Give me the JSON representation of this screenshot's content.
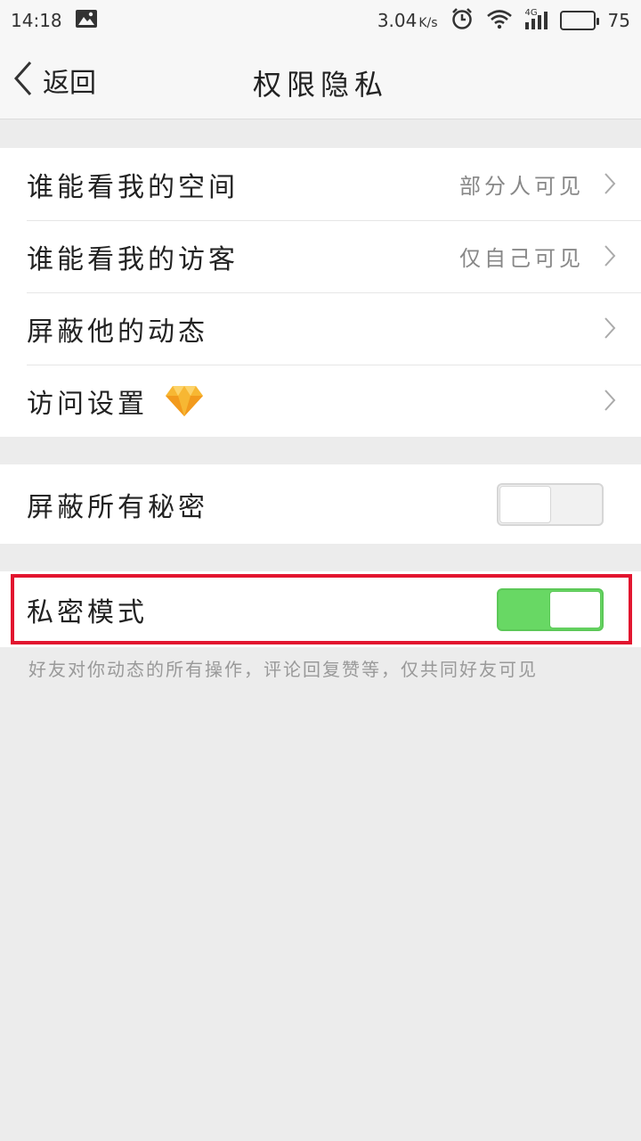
{
  "status_bar": {
    "time": "14:18",
    "speed": "3.04",
    "speed_unit": "K/s",
    "network": "4G",
    "battery": "75"
  },
  "header": {
    "back_label": "返回",
    "title": "权限隐私"
  },
  "privacy_settings": [
    {
      "label": "谁能看我的空间",
      "value": "部分人可见"
    },
    {
      "label": "谁能看我的访客",
      "value": "仅自己可见"
    },
    {
      "label": "屏蔽他的动态",
      "value": ""
    },
    {
      "label": "访问设置",
      "value": "",
      "badge_icon": "diamond-icon"
    }
  ],
  "block_secrets": {
    "label": "屏蔽所有秘密",
    "enabled": false
  },
  "private_mode": {
    "label": "私密模式",
    "enabled": true
  },
  "private_mode_note": "好友对你动态的所有操作，评论回复赞等，仅共同好友可见",
  "colors": {
    "toggle_on": "#68d864",
    "highlight": "#e2152f",
    "background": "#ececec"
  },
  "icons": {
    "back": "chevron-left-icon",
    "row_arrow": "chevron-right-icon",
    "vip": "diamond-icon"
  }
}
